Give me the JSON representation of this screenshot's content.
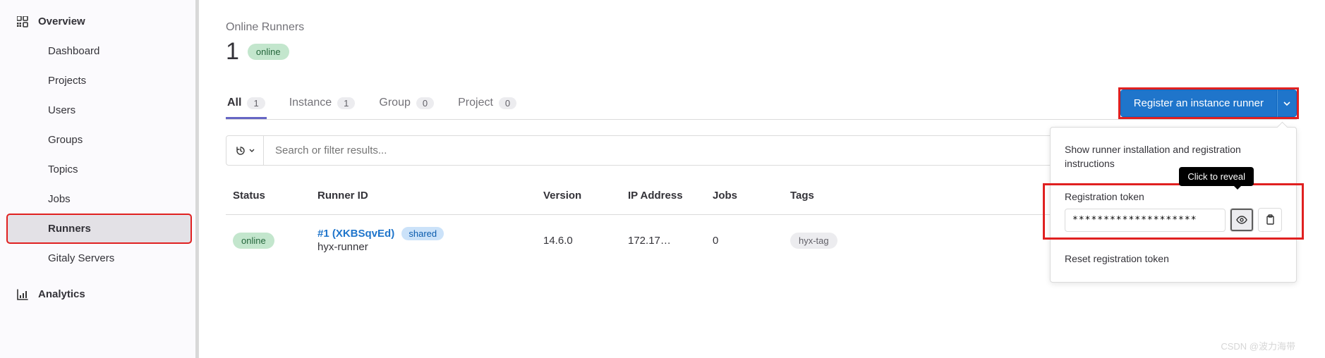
{
  "sidebar": {
    "overview": "Overview",
    "items": [
      "Dashboard",
      "Projects",
      "Users",
      "Groups",
      "Topics",
      "Jobs",
      "Runners",
      "Gitaly Servers"
    ],
    "analytics": "Analytics"
  },
  "header": {
    "title": "Online Runners",
    "count": "1",
    "status": "online"
  },
  "tabs": [
    {
      "label": "All",
      "count": "1"
    },
    {
      "label": "Instance",
      "count": "1"
    },
    {
      "label": "Group",
      "count": "0"
    },
    {
      "label": "Project",
      "count": "0"
    }
  ],
  "register_button": "Register an instance runner",
  "search": {
    "placeholder": "Search or filter results..."
  },
  "table": {
    "headers": {
      "status": "Status",
      "runner_id": "Runner ID",
      "version": "Version",
      "ip": "IP Address",
      "jobs": "Jobs",
      "tags": "Tags"
    },
    "rows": [
      {
        "status": "online",
        "link": "#1 (XKBSqvEd)",
        "badge": "shared",
        "desc": "hyx-runner",
        "version": "14.6.0",
        "ip": "172.17…",
        "jobs": "0",
        "tag": "hyx-tag"
      }
    ]
  },
  "dropdown": {
    "instructions": "Show runner installation and registration instructions",
    "token_label": "Registration token",
    "token_value": "********************",
    "tooltip": "Click to reveal",
    "reset": "Reset registration token"
  },
  "watermark": "CSDN @波力海带"
}
